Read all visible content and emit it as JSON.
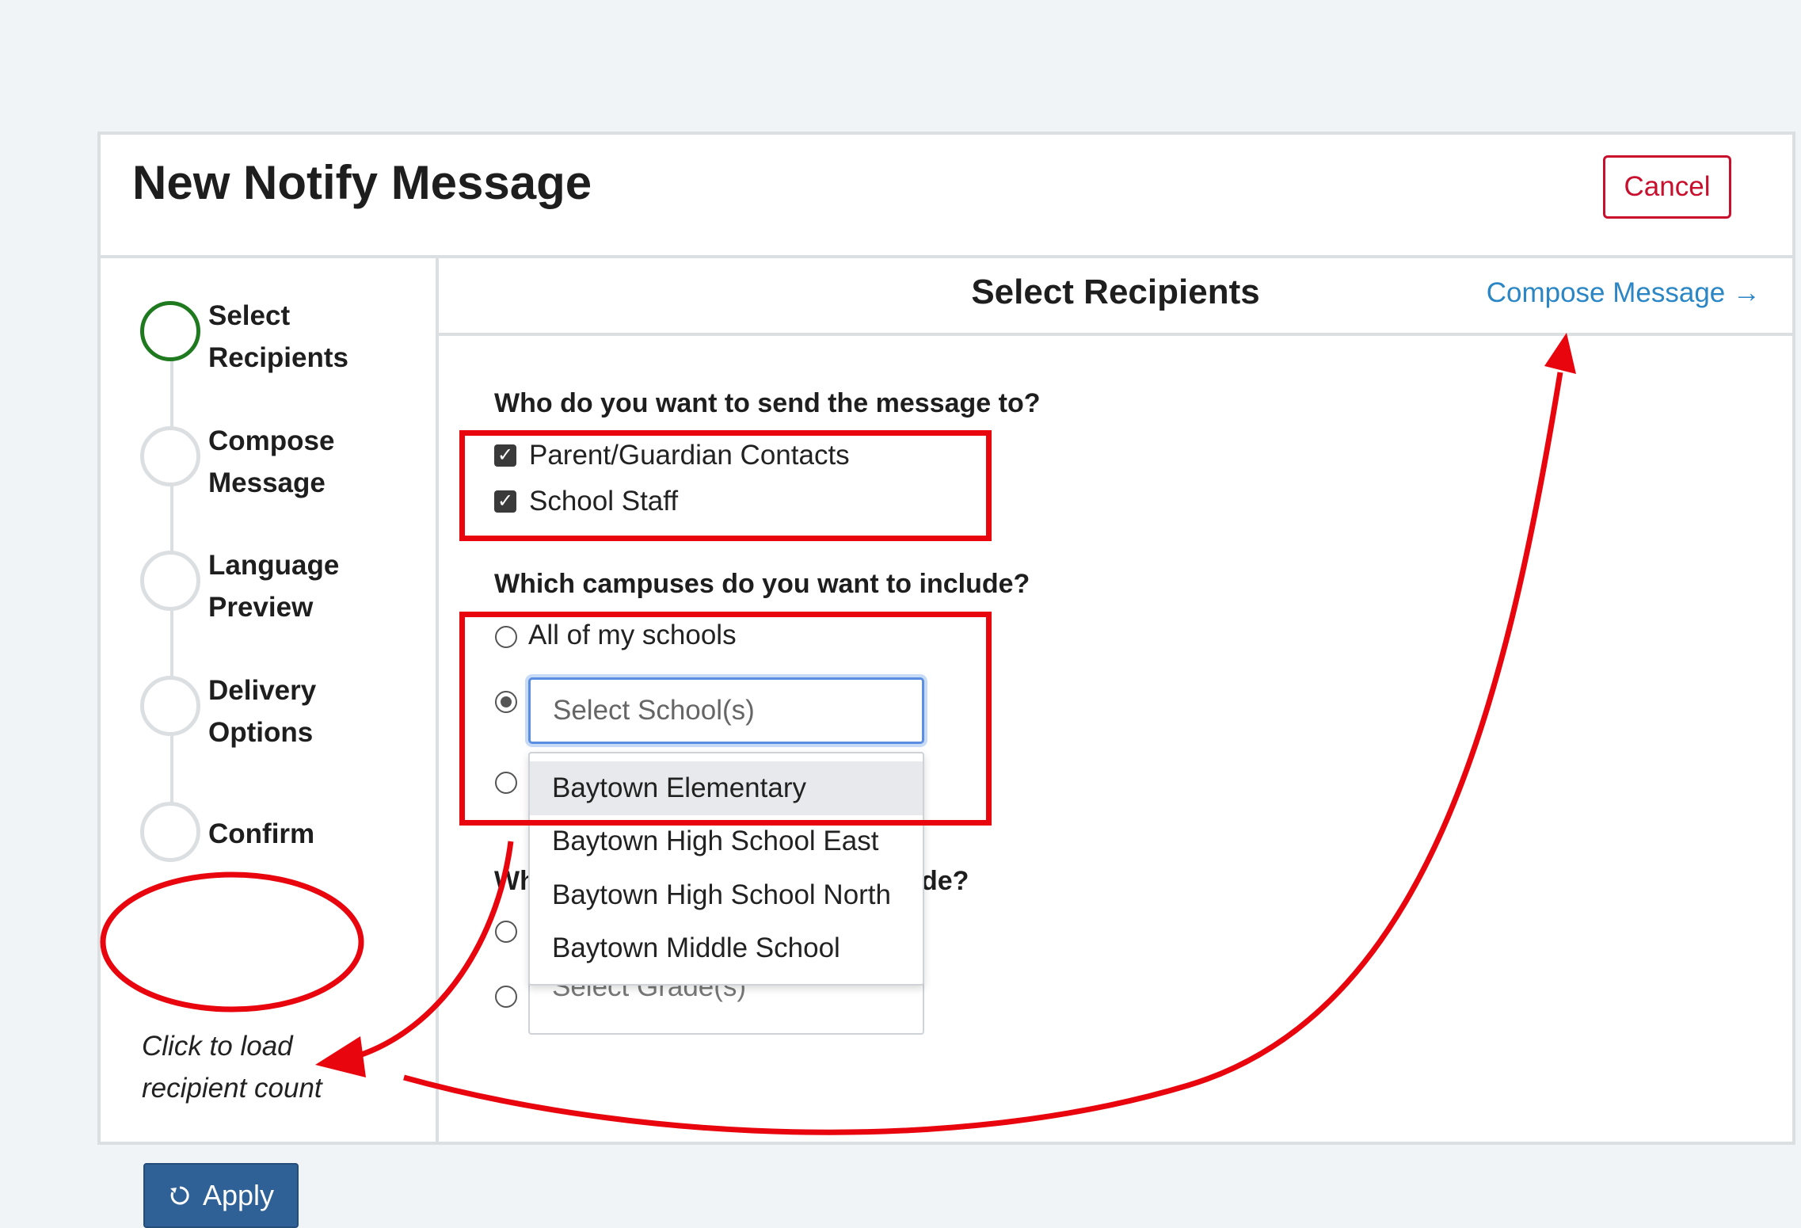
{
  "header": {
    "title": "New Notify Message",
    "cancel_label": "Cancel"
  },
  "stepper": {
    "steps": [
      {
        "line1": "Select",
        "line2": "Recipients",
        "active": true
      },
      {
        "line1": "Compose",
        "line2": "Message",
        "active": false
      },
      {
        "line1": "Language",
        "line2": "Preview",
        "active": false
      },
      {
        "line1": "Delivery",
        "line2": "Options",
        "active": false
      },
      {
        "line1": "Confirm",
        "line2": "",
        "active": false
      }
    ],
    "count_note_line1": "Click to load",
    "count_note_line2": "recipient count",
    "apply_label": "Apply"
  },
  "main": {
    "title": "Select Recipients",
    "next_link": "Compose Message →",
    "q1": "Who do you want to send the message to?",
    "q1_options": [
      "Parent/Guardian Contacts",
      "School Staff"
    ],
    "q2": "Which campuses do you want to include?",
    "q2_all": "All of my schools",
    "school_placeholder": "Select School(s)",
    "school_options": [
      "Baytown Elementary",
      "Baytown High School East",
      "Baytown High School North",
      "Baytown Middle School"
    ],
    "q3_left": "Wh",
    "q3_right": "de?",
    "grade_placeholder": "Select Grade(s)"
  },
  "colors": {
    "accent": "#2f6197",
    "annotation": "#e8050e",
    "active_step": "#1f7a1f",
    "cancel": "#c8102e",
    "link": "#2b86c5"
  }
}
